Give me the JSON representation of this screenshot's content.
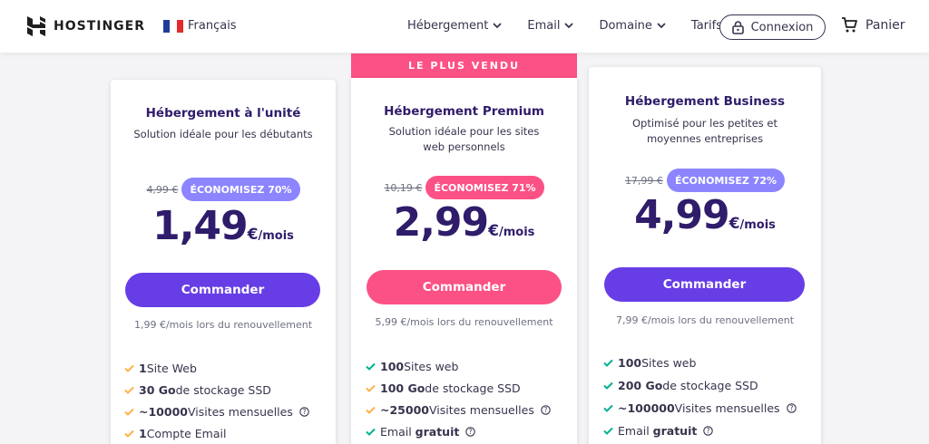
{
  "header": {
    "brand": "HOSTINGER",
    "language": "Français",
    "nav": [
      {
        "label": "Hébergement"
      },
      {
        "label": "Email"
      },
      {
        "label": "Domaine"
      },
      {
        "label": "Tarifs"
      }
    ],
    "login_label": "Connexion",
    "cart_label": "Panier"
  },
  "colors": {
    "purple": "#673de6",
    "pink": "#fc5185",
    "badge_purple": "#8c85ff",
    "dark_text": "#2f1c6a",
    "check_orange": "#ffb147",
    "check_green": "#00b090"
  },
  "plans": [
    {
      "title": "Hébergement à l'unité",
      "subtitle": "Solution idéale pour les débutants",
      "old_price": "4,99 €",
      "badge": "ÉCONOMISEZ 70%",
      "price_int": "1,49",
      "price_currency": "€",
      "price_period": "/mois",
      "cta": "Commander",
      "renewal": "1,99 €/mois lors du renouvellement",
      "features": [
        {
          "bold": "1",
          "text": " Site Web",
          "help": false,
          "check": "orange"
        },
        {
          "bold": "30 Go",
          "text": " de stockage SSD",
          "help": false,
          "check": "orange"
        },
        {
          "bold": "~10000",
          "text": " Visites mensuelles",
          "help": true,
          "check": "orange"
        },
        {
          "bold": "1",
          "text": " Compte Email",
          "help": false,
          "check": "orange"
        }
      ]
    },
    {
      "ribbon": "LE PLUS VENDU",
      "title": "Hébergement Premium",
      "subtitle": "Solution idéale pour les sites web personnels",
      "old_price": "10,19 €",
      "badge": "ÉCONOMISEZ 71%",
      "price_int": "2,99",
      "price_currency": "€",
      "price_period": "/mois",
      "cta": "Commander",
      "renewal": "5,99 €/mois lors du renouvellement",
      "features": [
        {
          "bold": "100",
          "text": " Sites web",
          "help": false,
          "check": "green"
        },
        {
          "bold": "100 Go",
          "text": " de stockage SSD",
          "help": false,
          "check": "orange"
        },
        {
          "bold": "~25000",
          "text": " Visites mensuelles",
          "help": true,
          "check": "orange"
        },
        {
          "pre": "Email ",
          "bold": "gratuit",
          "text": "",
          "help": true,
          "check": "green"
        }
      ]
    },
    {
      "title": "Hébergement Business",
      "subtitle": "Optimisé pour les petites et moyennes entreprises",
      "old_price": "17,99 €",
      "badge": "ÉCONOMISEZ 72%",
      "price_int": "4,99",
      "price_currency": "€",
      "price_period": "/mois",
      "cta": "Commander",
      "renewal": "7,99 €/mois lors du renouvellement",
      "features": [
        {
          "bold": "100",
          "text": " Sites web",
          "help": false,
          "check": "green"
        },
        {
          "bold": "200 Go",
          "text": " de stockage SSD",
          "help": false,
          "check": "green"
        },
        {
          "bold": "~100000",
          "text": " Visites mensuelles",
          "help": true,
          "check": "green"
        },
        {
          "pre": "Email ",
          "bold": "gratuit",
          "text": "",
          "help": true,
          "check": "green"
        }
      ]
    }
  ]
}
